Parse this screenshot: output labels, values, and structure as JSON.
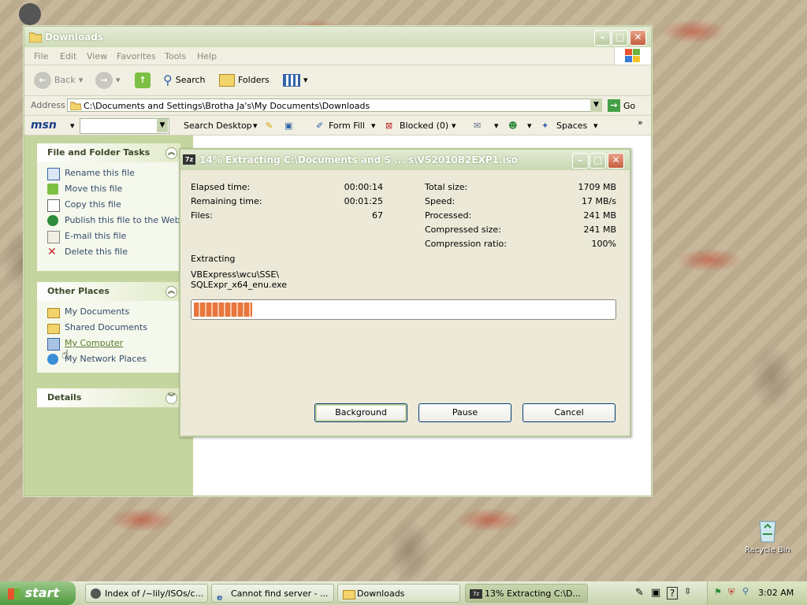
{
  "desktop": {
    "recycle_bin": "Recycle Bin"
  },
  "explorer": {
    "title": "Downloads",
    "menu": [
      "File",
      "Edit",
      "View",
      "Favorites",
      "Tools",
      "Help"
    ],
    "toolbar": {
      "back": "Back",
      "search": "Search",
      "folders": "Folders"
    },
    "address": {
      "label": "Address",
      "value": "C:\\Documents and Settings\\Brotha Ja's\\My Documents\\Downloads",
      "go": "Go"
    },
    "msn": {
      "logo": "msn",
      "search_desktop": "Search Desktop",
      "form_fill": "Form Fill",
      "blocked": "Blocked (0)",
      "spaces": "Spaces"
    },
    "tasks": {
      "header": "File and Folder Tasks",
      "items": [
        "Rename this file",
        "Move this file",
        "Copy this file",
        "Publish this file to the Web",
        "E-mail this file",
        "Delete this file"
      ]
    },
    "other_places": {
      "header": "Other Places",
      "items": [
        "My Documents",
        "Shared Documents",
        "My Computer",
        "My Network Places"
      ]
    },
    "details": {
      "header": "Details"
    }
  },
  "dialog": {
    "title": "14% Extracting C:\\Documents and S ... s\\VS2010B2EXP1.iso",
    "icon_label": "7z",
    "left": [
      {
        "label": "Elapsed time:",
        "value": "00:00:14"
      },
      {
        "label": "Remaining time:",
        "value": "00:01:25"
      },
      {
        "label": "Files:",
        "value": "67"
      }
    ],
    "right": [
      {
        "label": "Total size:",
        "value": "1709 MB"
      },
      {
        "label": "Speed:",
        "value": "17 MB/s"
      },
      {
        "label": "Processed:",
        "value": "241 MB"
      },
      {
        "label": "Compressed size:",
        "value": "241 MB"
      },
      {
        "label": "Compression ratio:",
        "value": "100%"
      }
    ],
    "status": "Extracting",
    "path_line1": "VBExpress\\wcu\\SSE\\",
    "path_line2": "SQLExpr_x64_enu.exe",
    "progress": 0.14,
    "buttons": {
      "background": "Background",
      "pause": "Pause",
      "cancel": "Cancel"
    }
  },
  "taskbar": {
    "start": "start",
    "tasks": [
      "Index of /~lily/ISOs/c...",
      "Cannot find server - ...",
      "Downloads",
      "13% Extracting C:\\D..."
    ],
    "clock": "3:02 AM"
  }
}
